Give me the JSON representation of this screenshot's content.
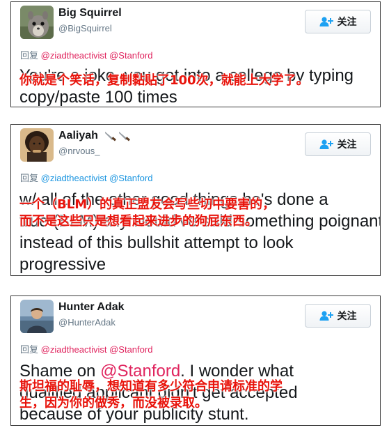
{
  "tweets": [
    {
      "name": "Big Squirrel",
      "handle": "@BigSquirrel",
      "follow_label": "关注",
      "reply_prefix": "回复",
      "reply_mentions": "@ziadtheactivist @Stanford",
      "body": "You're a joke, you got into a college by typing copy/paste 100 times",
      "body_part1": "You're a joke, you got into a college by typing",
      "body_part2": "copy/paste 100 times",
      "translation": "你就是个笑话，复制黏贴了100次，就能上大学了。",
      "avatar_icon": "squirrel-avatar"
    },
    {
      "name": "Aaliyah",
      "name_emoji": "knife-emoji",
      "handle": "@nrvous_",
      "follow_label": "关注",
      "reply_prefix": "回复",
      "reply_mentions": "@ziadtheactivist @Stanford",
      "body_lines": [
        "w/ all of the other good things he's done a",
        "true (BLM) ally would've said something poignant",
        "instead of this bullshit attempt to look",
        "progressive"
      ],
      "translation_lines": [
        "一个（BLM）的真正盟友会写些切中要害的，",
        "而不是这些只是想看起来进步的狗屁东西。"
      ],
      "avatar_icon": "person-avatar"
    },
    {
      "name": "Hunter Adak",
      "handle": "@HunterAdak",
      "follow_label": "关注",
      "reply_prefix": "回复",
      "reply_mentions": "@ziadtheactivist @Stanford",
      "body_prefix": "Shame on ",
      "body_mention": "@Stanford",
      "body_line1_rest": ". I wonder what",
      "body_line2": "qualified applicant didn't get accepted",
      "body_line3": "because of your publicity stunt.",
      "translation_lines": [
        "斯坦福的耻辱，想知道有多少符合申请标准的学",
        "生，因为你的做秀，而没被录取。"
      ],
      "avatar_icon": "person-avatar"
    }
  ],
  "colors": {
    "overlay_text": "#e8130b",
    "mention_red": "#e0245e",
    "mention_blue": "#1b95e0",
    "handle_gray": "#657786",
    "follow_icon": "#1da1f2"
  }
}
